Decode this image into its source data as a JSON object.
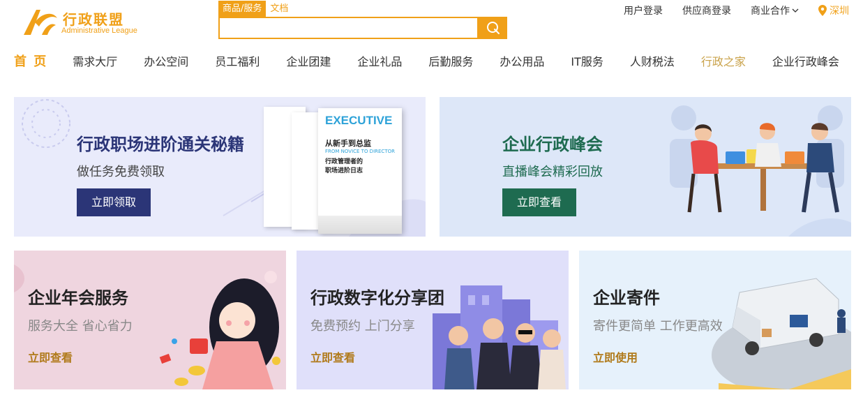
{
  "header": {
    "logo_cn": "行政联盟",
    "logo_en": "Administrative League",
    "search_tabs": [
      "商品/服务",
      "文档"
    ],
    "search_placeholder": "",
    "top_links": [
      "用户登录",
      "供应商登录",
      "商业合作"
    ],
    "city": "深圳"
  },
  "nav": {
    "items": [
      "首 页",
      "需求大厅",
      "办公空间",
      "员工福利",
      "企业团建",
      "企业礼品",
      "后勤服务",
      "办公用品",
      "IT服务",
      "人财税法",
      "行政之家",
      "企业行政峰会"
    ]
  },
  "banners": {
    "b1": {
      "title": "行政职场进阶通关秘籍",
      "subtitle": "做任务免费领取",
      "button": "立即领取",
      "book_en": "EXECUTIVE",
      "book_title1": "从新手到总监",
      "book_title2": "行政管理者的",
      "book_title3": "职场进阶日志",
      "book_sub": "FROM NOVICE TO DIRECTOR"
    },
    "b2": {
      "title": "企业行政峰会",
      "subtitle": "直播峰会精彩回放",
      "button": "立即查看"
    },
    "b3": {
      "title": "企业年会服务",
      "subtitle": "服务大全 省心省力",
      "link": "立即查看"
    },
    "b4": {
      "title": "行政数字化分享团",
      "subtitle": "免费预约 上门分享",
      "link": "立即查看"
    },
    "b5": {
      "title": "企业寄件",
      "subtitle": "寄件更简单 工作更高效",
      "link": "立即使用"
    }
  },
  "colors": {
    "brand": "#f0a018",
    "navy": "#2b3577",
    "green": "#1e6b50"
  }
}
